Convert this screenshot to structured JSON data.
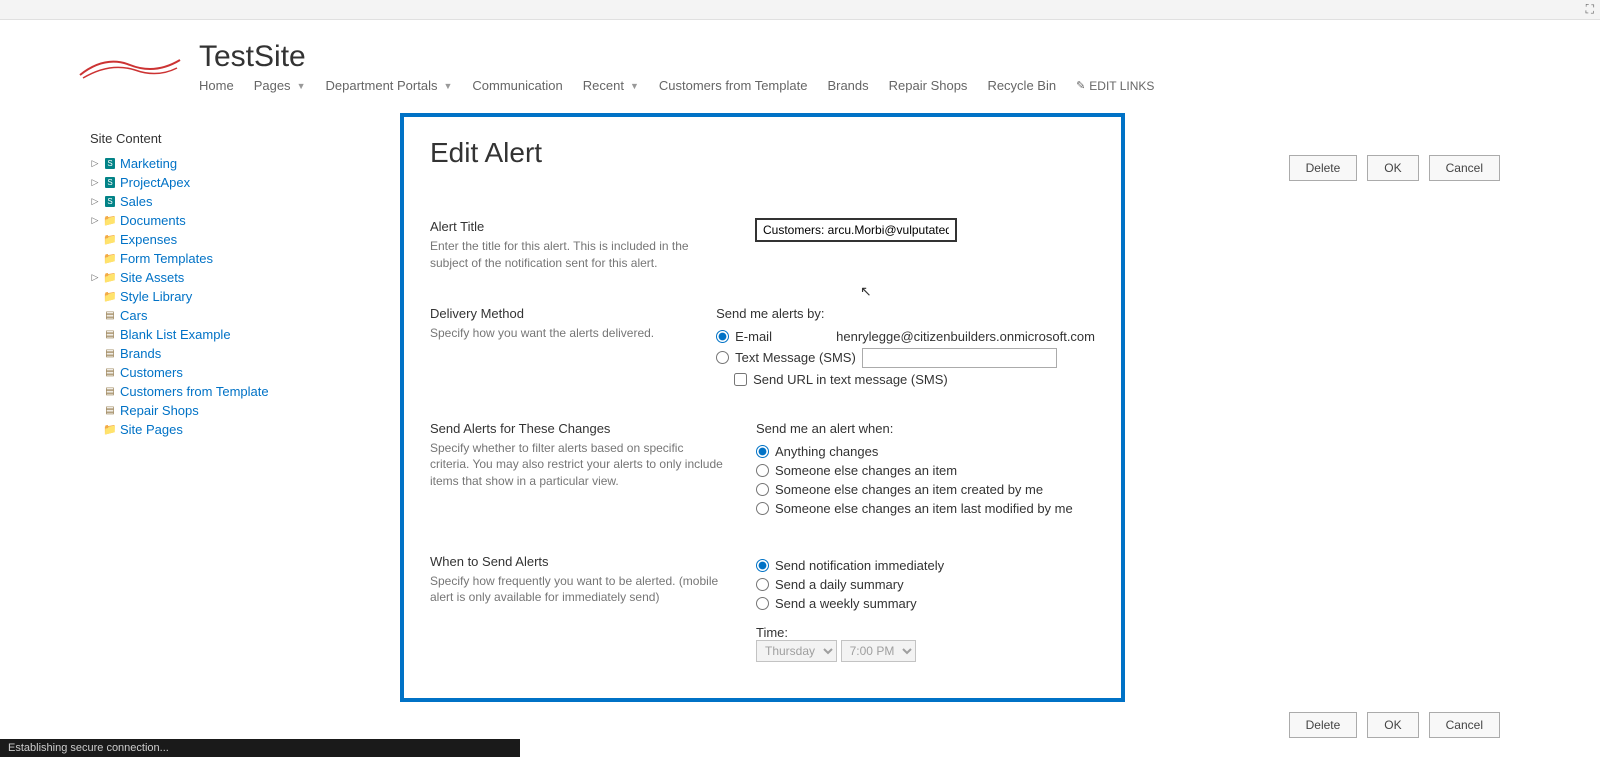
{
  "site": {
    "title": "TestSite"
  },
  "nav": {
    "items": [
      "Home",
      "Pages",
      "Department Portals",
      "Communication",
      "Recent",
      "Customers from Template",
      "Brands",
      "Repair Shops",
      "Recycle Bin"
    ],
    "edit_links": "EDIT LINKS"
  },
  "sidebar": {
    "title": "Site Content",
    "nodes": [
      {
        "label": "Marketing",
        "type": "sub",
        "expandable": true
      },
      {
        "label": "ProjectApex",
        "type": "sub",
        "expandable": true
      },
      {
        "label": "Sales",
        "type": "sub",
        "expandable": true
      },
      {
        "label": "Documents",
        "type": "fold",
        "expandable": true
      },
      {
        "label": "Expenses",
        "type": "fold",
        "expandable": false
      },
      {
        "label": "Form Templates",
        "type": "fold",
        "expandable": false
      },
      {
        "label": "Site Assets",
        "type": "fold",
        "expandable": true
      },
      {
        "label": "Style Library",
        "type": "fold",
        "expandable": false
      },
      {
        "label": "Cars",
        "type": "list",
        "expandable": false
      },
      {
        "label": "Blank List Example",
        "type": "list",
        "expandable": false
      },
      {
        "label": "Brands",
        "type": "list",
        "expandable": false
      },
      {
        "label": "Customers",
        "type": "list",
        "expandable": false
      },
      {
        "label": "Customers from Template",
        "type": "list",
        "expandable": false
      },
      {
        "label": "Repair Shops",
        "type": "list",
        "expandable": false
      },
      {
        "label": "Site Pages",
        "type": "fold",
        "expandable": false
      }
    ]
  },
  "panel": {
    "title": "Edit Alert",
    "alert_title": {
      "heading": "Alert Title",
      "desc": "Enter the title for this alert. This is included in the subject of the notification sent for this alert.",
      "value": "Customers: arcu.Morbi@vulputateduinec."
    },
    "delivery": {
      "heading": "Delivery Method",
      "desc": "Specify how you want the alerts delivered.",
      "send_by_label": "Send me alerts by:",
      "email_label": "E-mail",
      "email_value": "henrylegge@citizenbuilders.onmicrosoft.com",
      "sms_label": "Text Message (SMS)",
      "sms_value": "",
      "send_url_label": "Send URL in text message (SMS)"
    },
    "changes": {
      "heading": "Send Alerts for These Changes",
      "desc": "Specify whether to filter alerts based on specific criteria. You may also restrict your alerts to only include items that show in a particular view.",
      "when_label": "Send me an alert when:",
      "options": [
        "Anything changes",
        "Someone else changes an item",
        "Someone else changes an item created by me",
        "Someone else changes an item last modified by me"
      ]
    },
    "when": {
      "heading": "When to Send Alerts",
      "desc": "Specify how frequently you want to be alerted. (mobile alert is only available for immediately send)",
      "options": [
        "Send notification immediately",
        "Send a daily summary",
        "Send a weekly summary"
      ],
      "time_label": "Time:",
      "day": "Thursday",
      "hour": "7:00 PM"
    }
  },
  "buttons": {
    "delete": "Delete",
    "ok": "OK",
    "cancel": "Cancel"
  },
  "status_bar": "Establishing secure connection..."
}
